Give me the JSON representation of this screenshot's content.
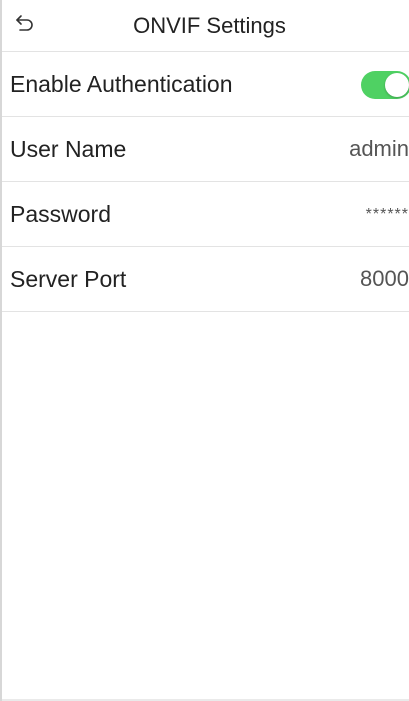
{
  "header": {
    "title": "ONVIF Settings",
    "back_icon": "back-arrow-icon"
  },
  "settings": [
    {
      "label": "Enable Authentication",
      "type": "toggle",
      "enabled": true
    },
    {
      "label": "User Name",
      "value": "admin"
    },
    {
      "label": "Password",
      "value": "******"
    },
    {
      "label": "Server Port",
      "value": "8000"
    }
  ],
  "colors": {
    "toggle_on": "#4fd163",
    "text": "#222222",
    "divider": "#e3e3e3"
  }
}
